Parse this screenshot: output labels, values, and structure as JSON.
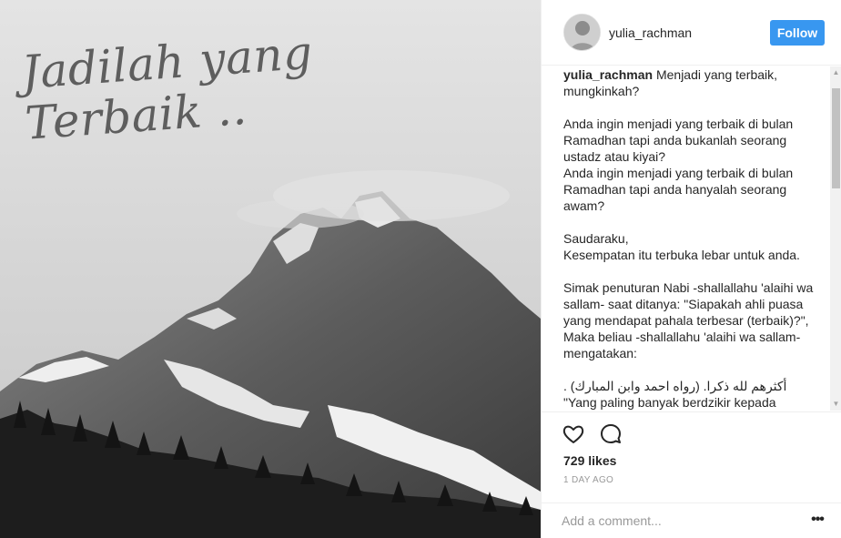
{
  "post": {
    "image_overlay_text": "Jadilah yang\nTerbaik ..",
    "image_alt_icon": "mountain-photo"
  },
  "header": {
    "username": "yulia_rachman",
    "follow_label": "Follow"
  },
  "caption": {
    "author": "yulia_rachman",
    "first_line": "Menjadi yang terbaik, mungkinkah?",
    "paragraphs": [
      "Anda ingin menjadi yang terbaik di bulan Ramadhan tapi anda bukanlah seorang ustadz atau kiyai?\nAnda ingin menjadi yang terbaik di bulan Ramadhan tapi anda hanyalah seorang awam?",
      "Saudaraku,\nKesempatan itu terbuka lebar untuk anda.",
      "Simak penuturan Nabi -shallallahu 'alaihi wa sallam- saat ditanya: \"Siapakah ahli puasa yang mendapat pahala terbesar (terbaik)?\", Maka beliau -shallallahu 'alaihi wa sallam- mengatakan:"
    ],
    "arabic": ". (أكثرهم لله ذكرا. (رواه احمد وابن المبارك",
    "last_line": "\"Yang paling banyak berdzikir kepada"
  },
  "actions": {
    "like_icon": "heart-outline-icon",
    "comment_icon": "speech-bubble-icon",
    "likes": "729 likes",
    "timestamp": "1 DAY AGO"
  },
  "comment_box": {
    "placeholder": "Add a comment...",
    "more_icon": "more-options-icon"
  },
  "colors": {
    "follow_button": "#3897f0",
    "border": "#efefef",
    "muted_text": "#999999"
  }
}
